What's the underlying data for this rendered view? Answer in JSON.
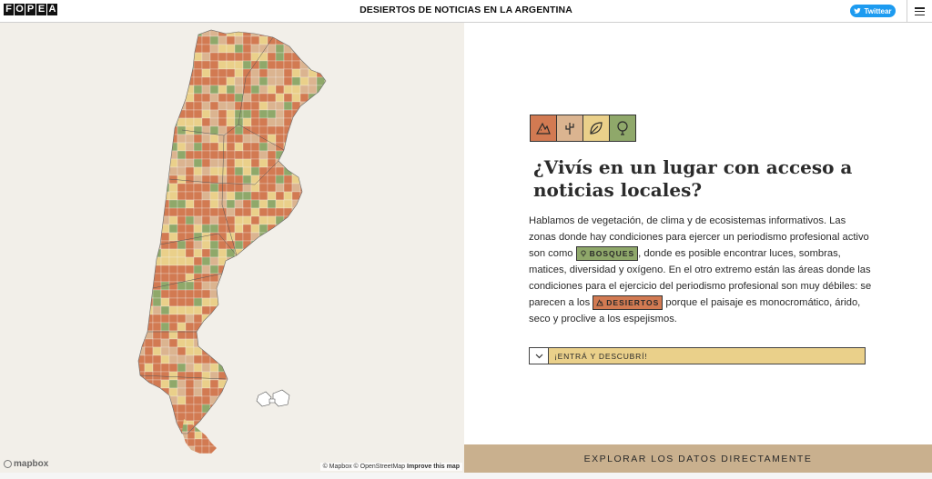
{
  "header": {
    "logo_letters": [
      "F",
      "O",
      "P",
      "E",
      "A"
    ],
    "title": "DESIERTOS DE NOTICIAS EN LA ARGENTINA",
    "tweet_label": "Twittear",
    "menu_icon": "hamburger-icon"
  },
  "map": {
    "colors": {
      "desierto": "#d27a52",
      "semidesierto": "#dbb490",
      "semibosque": "#ead08a",
      "bosque": "#8fa86a",
      "background": "#f2efe9"
    },
    "mapbox_label": "mapbox",
    "attribution_mapbox": "© Mapbox",
    "attribution_osm": "© OpenStreetMap",
    "attribution_improve": "Improve this map"
  },
  "panel": {
    "icons": [
      {
        "name": "desert-icon",
        "color": "#d27a52"
      },
      {
        "name": "cactus-icon",
        "color": "#dbb490"
      },
      {
        "name": "leaf-icon",
        "color": "#ead08a"
      },
      {
        "name": "tree-icon",
        "color": "#8fa86a"
      }
    ],
    "headline": "¿Vivís en un lugar con acceso a noticias locales?",
    "body_part1": "Hablamos de vegetación, de clima y de ecosistemas informativos. Las zonas donde hay condiciones para ejercer un periodismo profesional activo son como ",
    "tag_bosques": "BOSQUES",
    "body_part2": ", donde es posible encontrar luces, sombras, matices, diversidad y oxígeno. En el otro extremo están las áreas donde las condiciones para el ejercicio del periodismo profesional son muy débiles: se parecen a los ",
    "tag_desiertos": "DESIERTOS",
    "body_part3": " porque el paisaje es monocromático, árido, seco y proclive a los espejismos.",
    "enter_label": "¡ENTRÁ Y DESCUBRÍ!"
  },
  "footer": {
    "explore_label": "EXPLORAR LOS DATOS DIRECTAMENTE"
  }
}
